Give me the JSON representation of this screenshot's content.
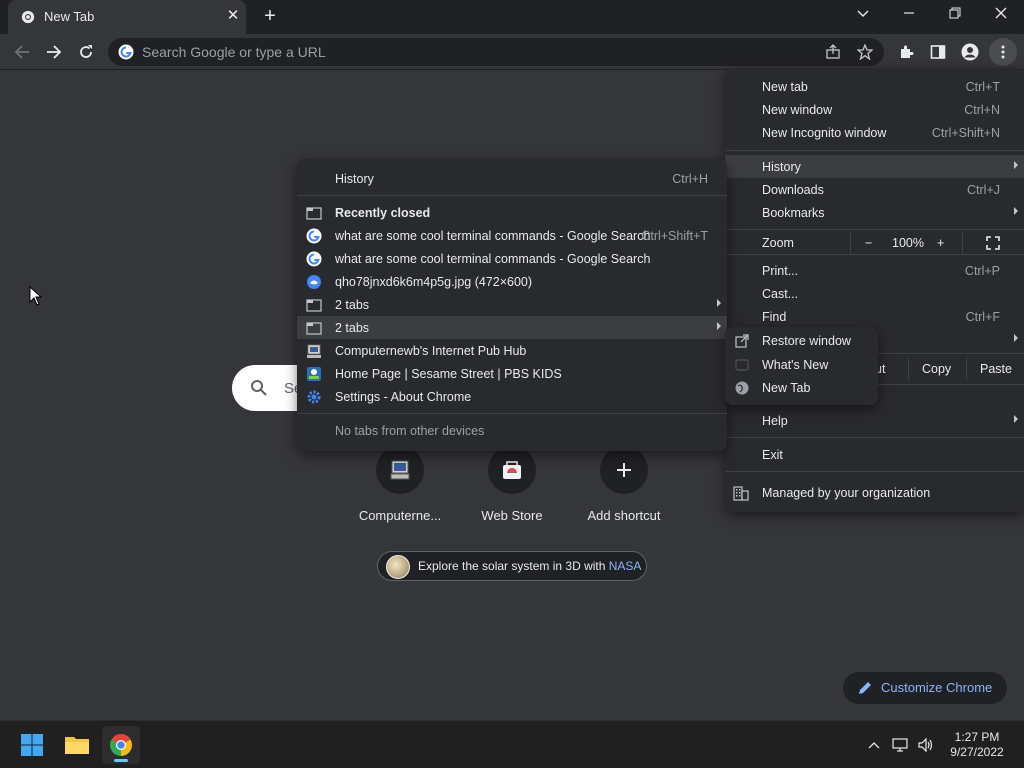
{
  "tab": {
    "title": "New Tab"
  },
  "omnibox": {
    "placeholder": "Search Google or type a URL"
  },
  "ntp": {
    "search_placeholder": "Se",
    "shortcuts": [
      {
        "label": "Computerne..."
      },
      {
        "label": "Web Store"
      },
      {
        "label": "Add shortcut"
      }
    ],
    "promo": {
      "text": "Explore the solar system in 3D with ",
      "link": "NASA"
    },
    "customize_label": "Customize Chrome"
  },
  "main_menu": {
    "new_tab": {
      "label": "New tab",
      "shortcut": "Ctrl+T"
    },
    "new_window": {
      "label": "New window",
      "shortcut": "Ctrl+N"
    },
    "new_incognito": {
      "label": "New Incognito window",
      "shortcut": "Ctrl+Shift+N"
    },
    "history": {
      "label": "History"
    },
    "downloads": {
      "label": "Downloads",
      "shortcut": "Ctrl+J"
    },
    "bookmarks": {
      "label": "Bookmarks"
    },
    "zoom": {
      "label": "Zoom",
      "minus": "−",
      "value": "100%",
      "plus": "+"
    },
    "print": {
      "label": "Print...",
      "shortcut": "Ctrl+P"
    },
    "cast": {
      "label": "Cast..."
    },
    "find": {
      "label": "Find",
      "shortcut": "Ctrl+F"
    },
    "edit": {
      "cut": "ut",
      "copy": "Copy",
      "paste": "Paste"
    },
    "help": {
      "label": "Help"
    },
    "exit": {
      "label": "Exit"
    },
    "managed": {
      "label": "Managed by your organization"
    }
  },
  "history_menu": {
    "history": {
      "label": "History",
      "shortcut": "Ctrl+H"
    },
    "recently_closed": "Recently closed",
    "items": [
      {
        "label": "what are some cool terminal commands - Google Search",
        "shortcut": "Ctrl+Shift+T"
      },
      {
        "label": "what are some cool terminal commands - Google Search",
        "shortcut": ""
      },
      {
        "label": "qho78jnxd6k6m4p5g.jpg (472×600)",
        "shortcut": ""
      },
      {
        "label": "2 tabs",
        "shortcut": ""
      },
      {
        "label": "2 tabs",
        "shortcut": ""
      },
      {
        "label": "Computernewb's Internet Pub Hub",
        "shortcut": ""
      },
      {
        "label": "Home Page | Sesame Street | PBS KIDS",
        "shortcut": ""
      },
      {
        "label": "Settings - About Chrome",
        "shortcut": ""
      }
    ],
    "no_tabs": "No tabs from other devices"
  },
  "tabs_submenu": {
    "restore": "Restore window",
    "items": [
      {
        "label": "What's New"
      },
      {
        "label": "New Tab"
      }
    ]
  },
  "taskbar": {
    "time": "1:27 PM",
    "date": "9/27/2022"
  },
  "colors": {
    "accent": "#8ab4f8",
    "bg": "#35363a",
    "menu_bg": "#292a2d",
    "titlebar": "#202124"
  }
}
